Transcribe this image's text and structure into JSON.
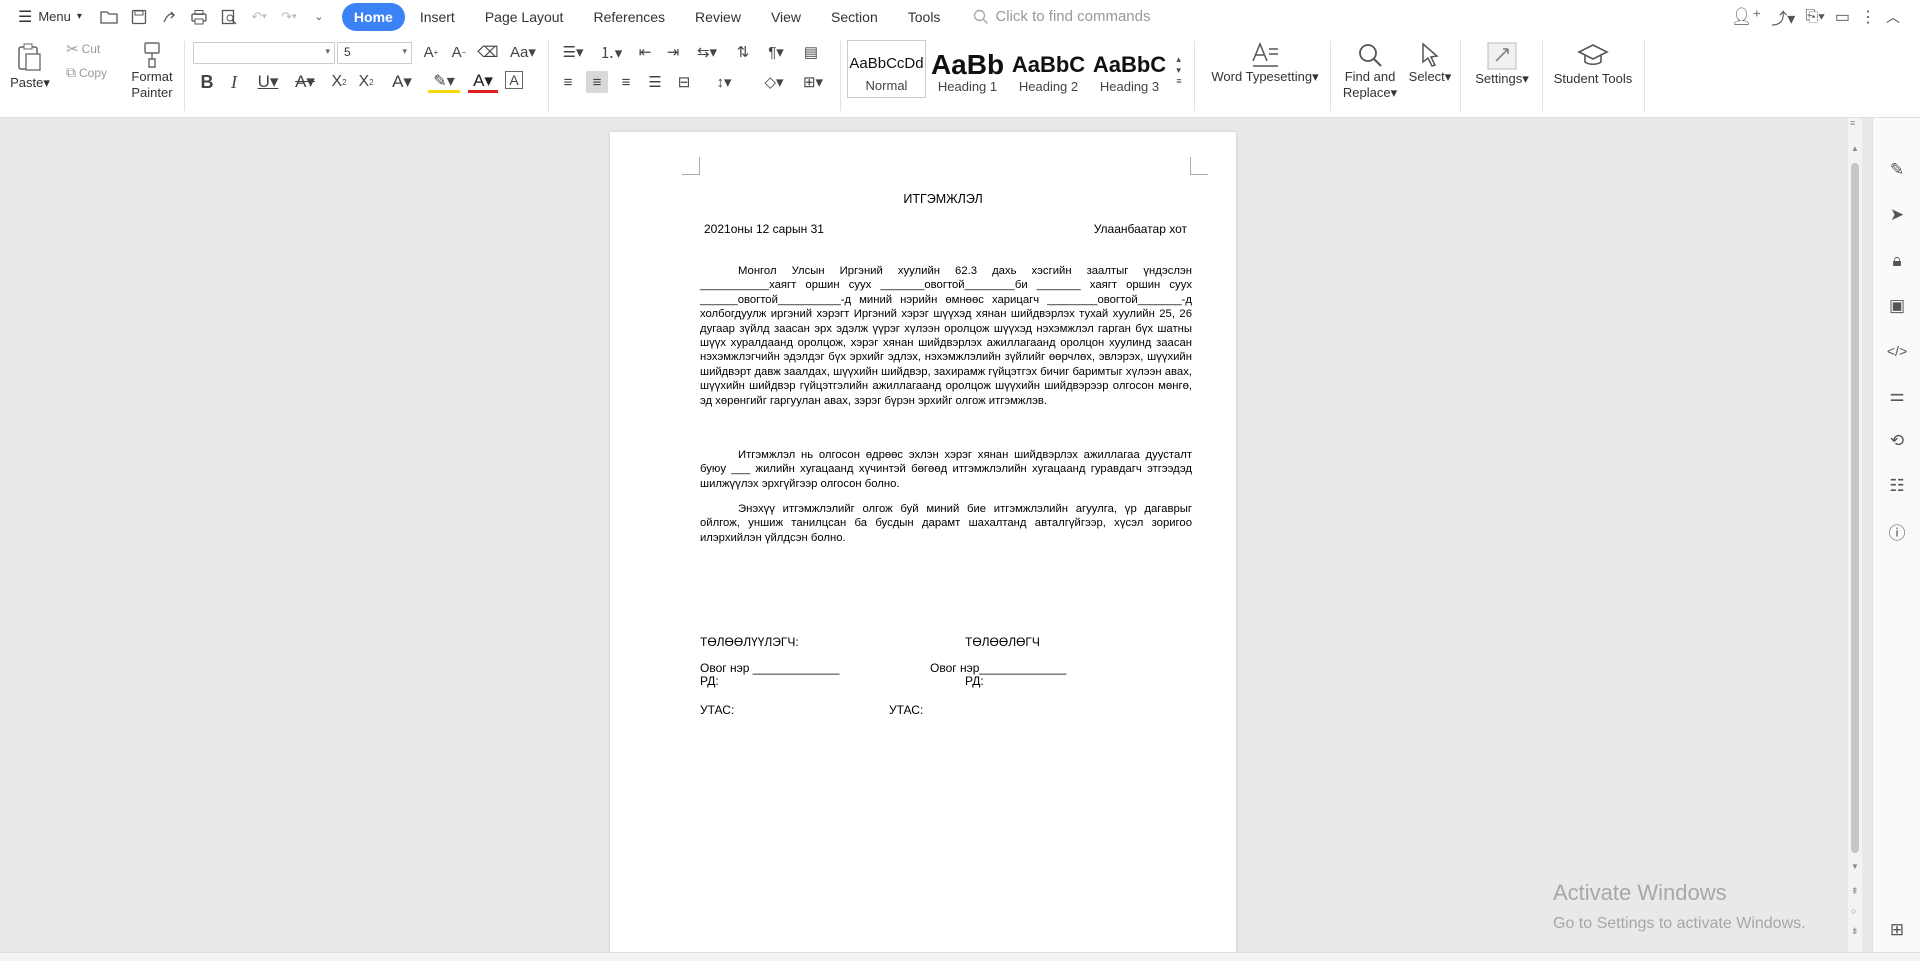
{
  "topbar": {
    "menu_label": "Menu",
    "tabs": [
      "Home",
      "Insert",
      "Page Layout",
      "References",
      "Review",
      "View",
      "Section",
      "Tools"
    ],
    "command_search_placeholder": "Click to find commands"
  },
  "ribbon": {
    "paste": "Paste",
    "cut": "Cut",
    "copy": "Copy",
    "format_painter_line1": "Format",
    "format_painter_line2": "Painter",
    "font_name": "",
    "font_size": "5",
    "styles": [
      {
        "preview": "AaBbCcDd",
        "label": "Normal"
      },
      {
        "preview": "AaBb",
        "label": "Heading 1"
      },
      {
        "preview": "AaBbC",
        "label": "Heading 2"
      },
      {
        "preview": "AaBbC",
        "label": "Heading 3"
      }
    ],
    "word_typesetting": "Word Typesetting",
    "find_replace_line1": "Find and",
    "find_replace_line2": "Replace",
    "select": "Select",
    "settings": "Settings",
    "student_tools": "Student Tools"
  },
  "document": {
    "title": "ИТГЭМЖЛЭЛ",
    "date": "2021оны 12 сарын 31",
    "city": "Улаанбаатар хот",
    "paragraph1": "Монгол Улсын Иргэний хуулийн 62.3 дахь хэсгийн заалтыг үндэслэн ___________хаягт оршин суух _______овогтой________би _______ хаягт оршин суух ______овогтой__________-д миний нэрийн өмнөөс харицагч ________овогтой_______-д холбогдуулж иргэний хэрэгт Иргэний хэрэг шүүхэд хянан шийдвэрлэх тухай хуулийн 25, 26 дугаар зүйлд заасан эрх эдэлж үүрэг хүлээн оролцож шүүхэд нэхэмжлэл гарган бүх шатны шүүх хуралдаанд оролцож, хэрэг хянан шийдвэрлэх ажиллагаанд оролцон хуулинд заасан нэхэмжлэгчийн эдэлдэг бүх эрхийг эдлэх, нэхэмжлэлийн зүйлийг өөрчлөх, эвлэрэх, шүүхийн шийдвэрт давж заалдах, шүүхийн шийдвэр, захирамж гүйцэтгэх бичиг баримтыг хүлээн авах, шүүхийн шийдвэр гүйцэтгэлийн ажиллагаанд оролцож шүүхийн шийдвэрээр олгосон мөнгө, эд хөрөнгийг гаргуулан авах, зэрэг бүрэн эрхийг олгож итгэмжлэв.",
    "paragraph2": "Итгэмжлэл нь олгосон өдрөөс эхлэн хэрэг хянан шийдвэрлэх ажиллагаа дуусталт буюу ___ жилийн хугацаанд хүчинтэй бөгөөд итгэмжлэлийн хугацаанд гуравдагч этгээдэд шилжүүлэх эрхгүйгээр олгосон болно.",
    "paragraph3": "Энэхүү итгэмжлэлийг олгож буй миний бие итгэмжлэлийн агуулга, үр дагаврыг ойлгож, уншиж танилцсан ба бусдын дарамт шахалтанд авталгүйгээр, хүсэл зоригоо илэрхийлэн үйлдсэн болно.",
    "sign_left_title": "ТӨЛӨӨЛҮҮЛЭГЧ:",
    "sign_right_title": "ТӨЛӨӨЛӨГЧ",
    "name_left": "Овог нэр _____________",
    "name_right": "Овог нэр_____________",
    "rd_left": "РД:",
    "rd_right": "РД:",
    "phone_left": "УТАС:",
    "phone_right": "УТАС:"
  },
  "watermark": {
    "line1": "Activate Windows",
    "line2": "Go to Settings to activate Windows."
  }
}
